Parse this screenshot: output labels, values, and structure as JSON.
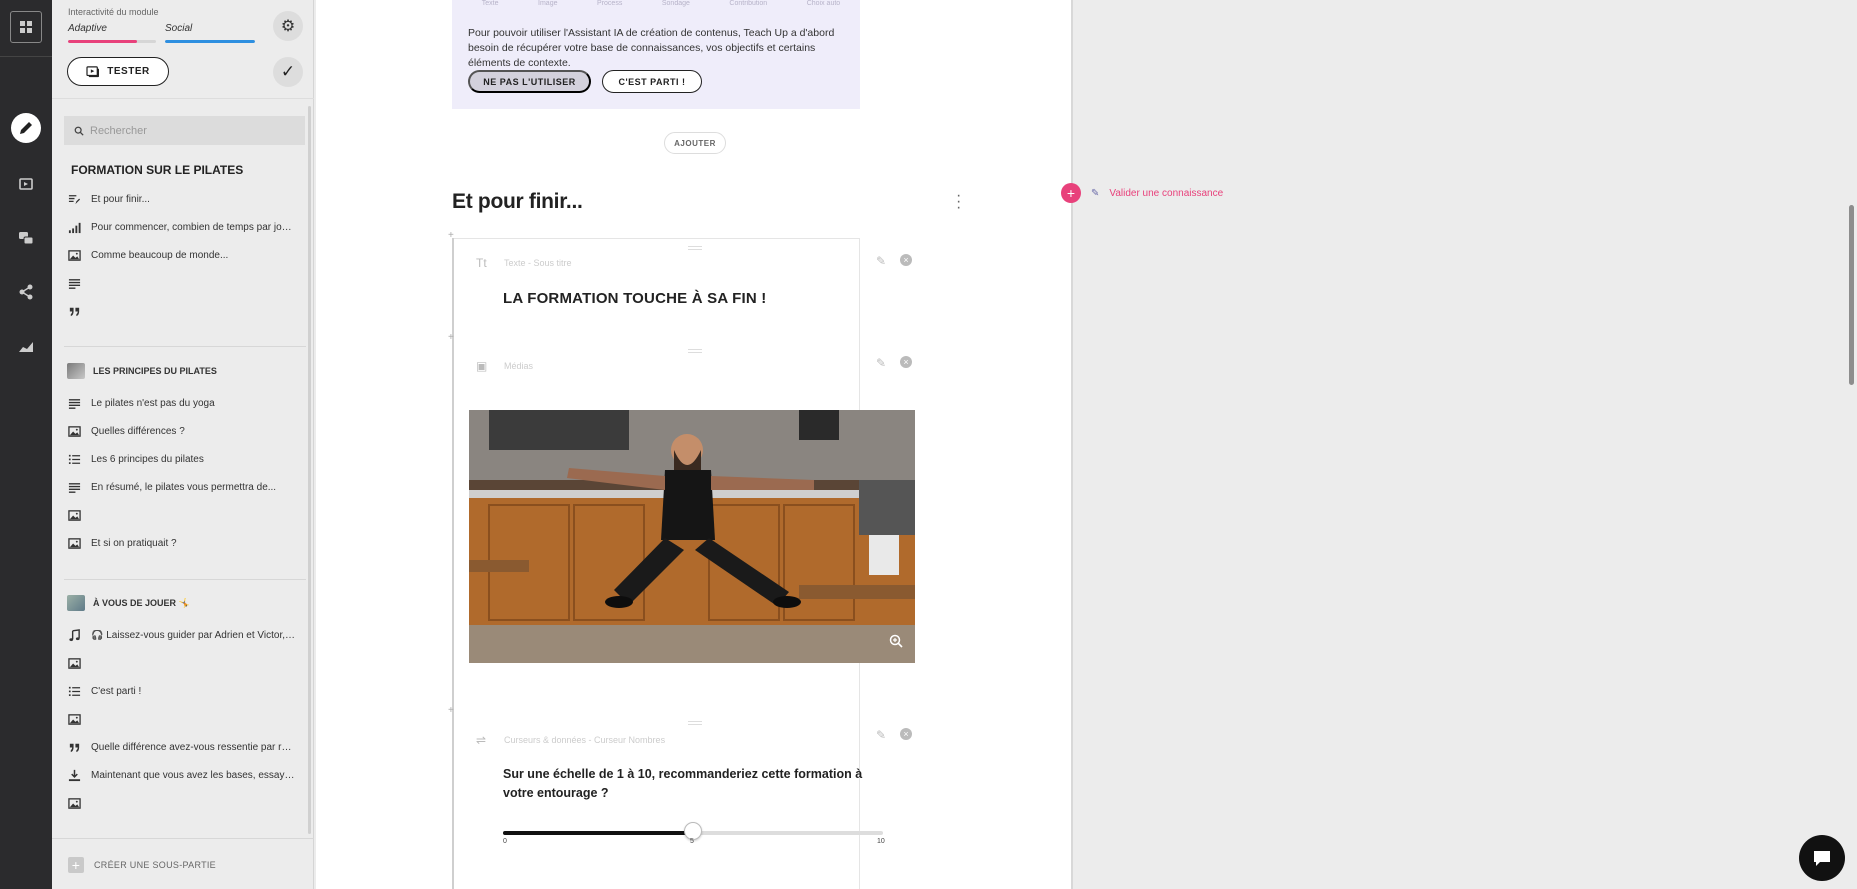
{
  "rail": {
    "items": [
      {
        "name": "edit-icon",
        "active": true
      },
      {
        "name": "media-icon",
        "active": false
      },
      {
        "name": "chat-bubbles-icon",
        "active": false
      },
      {
        "name": "share-icon",
        "active": false
      },
      {
        "name": "analytics-icon",
        "active": false
      }
    ]
  },
  "sidebar": {
    "module_label": "Interactivité du module",
    "tabs": [
      {
        "label": "Adaptive",
        "progress": 0.78,
        "color": "#e8417b"
      },
      {
        "label": "Social",
        "progress": 1.0,
        "color": "#2e8fe0"
      }
    ],
    "tester_label": "TESTER",
    "search_placeholder": "Rechercher",
    "section_title": "FORMATION SUR LE PILATES",
    "section_items": [
      {
        "icon": "edit-list-icon",
        "label": "Et pour finir..."
      },
      {
        "icon": "signal-bars-icon",
        "label": "Pour commencer, combien de temps par jour..."
      },
      {
        "icon": "image-icon",
        "label": "Comme beaucoup de monde..."
      },
      {
        "icon": "paragraph-icon",
        "label": ""
      },
      {
        "icon": "quote-icon",
        "label": ""
      }
    ],
    "chapter1": {
      "title": "LES PRINCIPES DU PILATES",
      "items": [
        {
          "icon": "paragraph-icon",
          "label": "Le pilates n'est pas du yoga"
        },
        {
          "icon": "image-icon",
          "label": "Quelles différences ?"
        },
        {
          "icon": "list-icon",
          "label": "Les 6 principes du pilates"
        },
        {
          "icon": "paragraph-icon",
          "label": "En résumé, le pilates vous permettra de..."
        },
        {
          "icon": "image-icon",
          "label": ""
        },
        {
          "icon": "image-icon",
          "label": "Et si on pratiquait ?"
        }
      ]
    },
    "chapter2": {
      "title": "À VOUS DE JOUER 🤸",
      "items": [
        {
          "icon": "music-icon",
          "label": "🎧 Laissez-vous guider par Adrien et Victor, e..."
        },
        {
          "icon": "image-icon",
          "label": ""
        },
        {
          "icon": "list-icon",
          "label": "C'est parti !"
        },
        {
          "icon": "image-icon",
          "label": ""
        },
        {
          "icon": "quote-icon",
          "label": "Quelle différence avez-vous ressentie par rap..."
        },
        {
          "icon": "download-icon",
          "label": "Maintenant que vous avez les bases, essayez..."
        },
        {
          "icon": "image-icon",
          "label": ""
        }
      ]
    },
    "create_label": "CRÉER UNE SOUS-PARTIE"
  },
  "content": {
    "ai_tabs": [
      "Texte",
      "Image",
      "Process",
      "Sondage",
      "Contribution",
      "Choix auto"
    ],
    "ai_text": "Pour pouvoir utiliser l'Assistant IA de création de contenus, Teach Up a d'abord besoin de récupérer votre base de connaissances, vos objectifs et certains éléments de contexte.",
    "ai_decline": "NE PAS L'UTILISER",
    "ai_accept": "C'EST PARTI !",
    "add_label": "AJOUTER",
    "section_heading": "Et pour finir...",
    "block1_type": "Texte - Sous titre",
    "block1_text": "LA FORMATION TOUCHE À SA FIN !",
    "block2_type": "Médias",
    "block3_type": "Curseurs & données - Curseur Nombres",
    "question": "Sur une échelle de 1 à 10, recommanderiez cette formation à votre entourage ?",
    "slider": {
      "min": "0",
      "max": "10",
      "value": "5",
      "fraction": 0.5
    }
  },
  "right": {
    "validate_label": "Valider une connaissance",
    "accent": "#e8417b"
  }
}
